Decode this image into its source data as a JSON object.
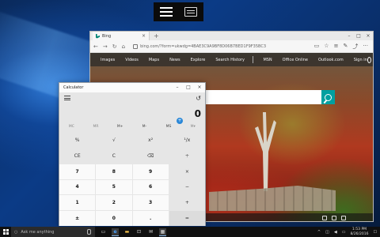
{
  "browser": {
    "tab_title": "Bing",
    "url": "bing.com/?form=ukwdg=4BAE3C9A9BF8D06B7BED1F9F35BC3",
    "bing_nav": [
      "Images",
      "Videos",
      "Maps",
      "News",
      "Explore",
      "Search History",
      "MSN",
      "Office Online",
      "Outlook.com",
      "Sign in"
    ]
  },
  "calculator": {
    "title": "Calculator",
    "display": "0",
    "memory": [
      "MC",
      "MR",
      "M+",
      "M-",
      "MS",
      "M▾"
    ],
    "keys": [
      [
        "%",
        "√",
        "x²",
        "¹/x"
      ],
      [
        "CE",
        "C",
        "⌫",
        "÷"
      ],
      [
        "7",
        "8",
        "9",
        "×"
      ],
      [
        "4",
        "5",
        "6",
        "−"
      ],
      [
        "1",
        "2",
        "3",
        "+"
      ],
      [
        "±",
        "0",
        ".",
        "="
      ]
    ]
  },
  "taskbar": {
    "search_placeholder": "Ask me anything",
    "time": "1:53 PM",
    "date": "8/26/2016"
  }
}
